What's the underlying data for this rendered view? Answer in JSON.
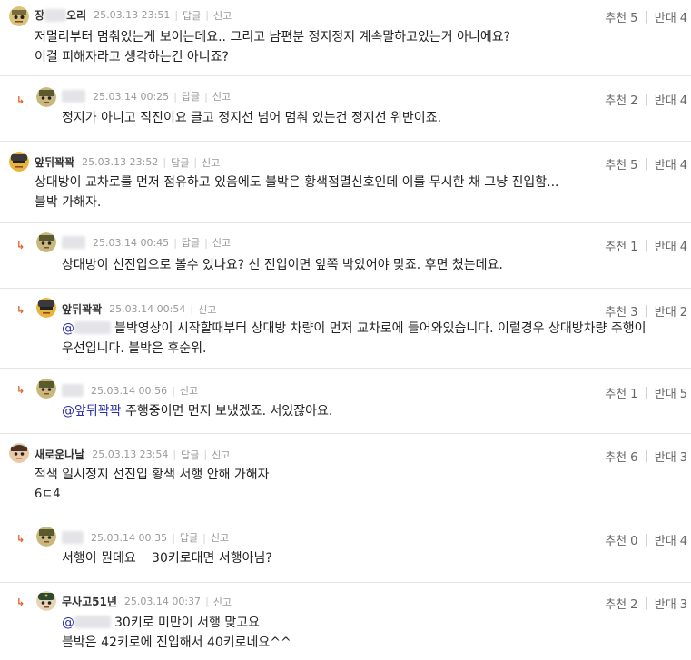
{
  "labels": {
    "reply": "답글",
    "report": "신고",
    "recommend": "추천",
    "oppose": "반대"
  },
  "comments": [
    {
      "nick_prefix": "장",
      "nick_suffix": "오리",
      "date": "25.03.13 23:51",
      "recommend": "5",
      "oppose": "4",
      "lines": [
        "저멀리부터 멈춰있는게 보이는데요.. 그리고 남편분 정지정지 계속말하고있는거 아니에요?",
        "이걸 피해자라고 생각하는건 아니죠?"
      ]
    },
    {
      "date": "25.03.14 00:25",
      "recommend": "2",
      "oppose": "4",
      "lines": [
        "정지가 아니고 직진이요 글고 정지선 넘어 멈춰 있는건 정지선 위반이죠."
      ]
    },
    {
      "nick": "앞뒤꽉꽉",
      "date": "25.03.13 23:52",
      "recommend": "5",
      "oppose": "4",
      "lines": [
        "상대방이 교차로를 먼저 점유하고 있음에도 블박은 황색점멸신호인데 이를 무시한 채 그냥 진입함...",
        "블박 가해자."
      ]
    },
    {
      "date": "25.03.14 00:45",
      "recommend": "1",
      "oppose": "4",
      "lines": [
        "상대방이 선진입으로 볼수 있나요? 선 진입이면 앞쪽 박았어야 맞죠. 후면 쳤는데요."
      ]
    },
    {
      "nick": "앞뒤꽉꽉",
      "date": "25.03.14 00:54",
      "recommend": "3",
      "oppose": "2",
      "mention_prefix": "@",
      "lines": [
        "블박영상이 시작할때부터 상대방 차량이 먼저 교차로에 들어와있습니다. 이럴경우 상대방차량 주행이",
        "우선입니다. 블박은 후순위."
      ]
    },
    {
      "date": "25.03.14 00:56",
      "recommend": "1",
      "oppose": "5",
      "mention": "@앞뒤꽉꽉",
      "lines": [
        "주행중이면 먼저 보냈겠죠. 서있잖아요."
      ]
    },
    {
      "nick": "새로운나날",
      "date": "25.03.13 23:54",
      "recommend": "6",
      "oppose": "3",
      "lines": [
        "적색 일시정지 선진입 황색 서행 안해 가해자",
        "6ㄷ4"
      ]
    },
    {
      "date": "25.03.14 00:35",
      "recommend": "0",
      "oppose": "4",
      "lines": [
        "서행이 뭔데요ㅡ 30키로대면 서행아님?"
      ]
    },
    {
      "nick": "무사고51년",
      "date": "25.03.14 00:37",
      "recommend": "2",
      "oppose": "3",
      "mention_prefix": "@",
      "lines": [
        "30키로 미만이 서행 맞고요",
        "블박은 42키로에 진입해서 40키로네요^^"
      ]
    }
  ]
}
